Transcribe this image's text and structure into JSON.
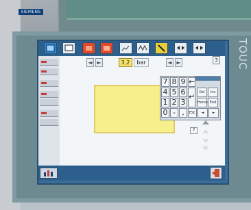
{
  "hardware": {
    "brand": "SIEMENS",
    "device_label": "TOUC"
  },
  "toolbar": {
    "buttons": [
      {
        "icon": "panel-icon",
        "color": "#2b82c6"
      },
      {
        "icon": "screen-icon",
        "color": "#e6edf3"
      },
      {
        "icon": "alarm-icon",
        "color": "#e04a2b"
      },
      {
        "icon": "alarm-ack-icon",
        "color": "#e04a2b"
      },
      {
        "icon": "chart-icon",
        "color": "#e6edf3"
      },
      {
        "icon": "trend-icon",
        "color": "#e6edf3"
      },
      {
        "icon": "tool-icon",
        "color": "#e7cf39"
      },
      {
        "icon": "arrows-icon",
        "color": "#e6edf3"
      },
      {
        "icon": "arrows-icon",
        "color": "#e6edf3"
      }
    ]
  },
  "input": {
    "value": "3,2",
    "unit": "bar"
  },
  "page_number": "3",
  "keypad": {
    "rows": [
      [
        "7",
        "8",
        "9"
      ],
      [
        "4",
        "5",
        "6"
      ],
      [
        "1",
        "2",
        "3"
      ],
      [
        "0",
        "-",
        ","
      ]
    ],
    "side_keys": {
      "backspace": "←",
      "enter": "↵",
      "del": "Del",
      "ins": "Ins",
      "home": "Home",
      "end": "End",
      "esc": "ESC",
      "left": "◄",
      "right": "►"
    }
  },
  "small_value": "7"
}
